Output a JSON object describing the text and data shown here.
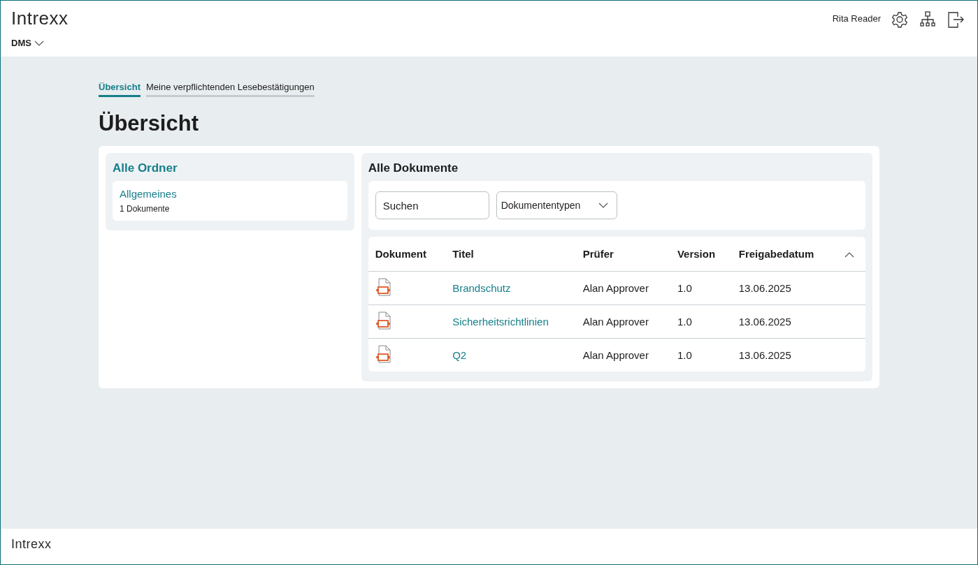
{
  "header": {
    "logo": "Intrexx",
    "user": "Rita Reader",
    "app_menu": "DMS"
  },
  "tabs": [
    {
      "label": "Übersicht",
      "selected": true
    },
    {
      "label": "Meine verpflichtenden Lesebestätigungen",
      "selected": false
    }
  ],
  "page_title": "Übersicht",
  "folders": {
    "title": "Alle Ordner",
    "items": [
      {
        "name": "Allgemeines",
        "count": "1 Dokumente"
      }
    ]
  },
  "documents": {
    "title": "Alle Dokumente",
    "search": {
      "placeholder": "Suchen"
    },
    "type_filter": "Dokumententypen",
    "columns": [
      "Dokument",
      "Titel",
      "Prüfer",
      "Version",
      "Freigabedatum"
    ],
    "rows": [
      {
        "title": "Brandschutz",
        "reviewer": "Alan Approver",
        "version": "1.0",
        "date": "13.06.2025"
      },
      {
        "title": "Sicherheitsrichtlinien",
        "reviewer": "Alan Approver",
        "version": "1.0",
        "date": "13.06.2025"
      },
      {
        "title": "Q2",
        "reviewer": "Alan Approver",
        "version": "1.0",
        "date": "13.06.2025"
      }
    ]
  },
  "footer": {
    "logo": "Intrexx"
  }
}
